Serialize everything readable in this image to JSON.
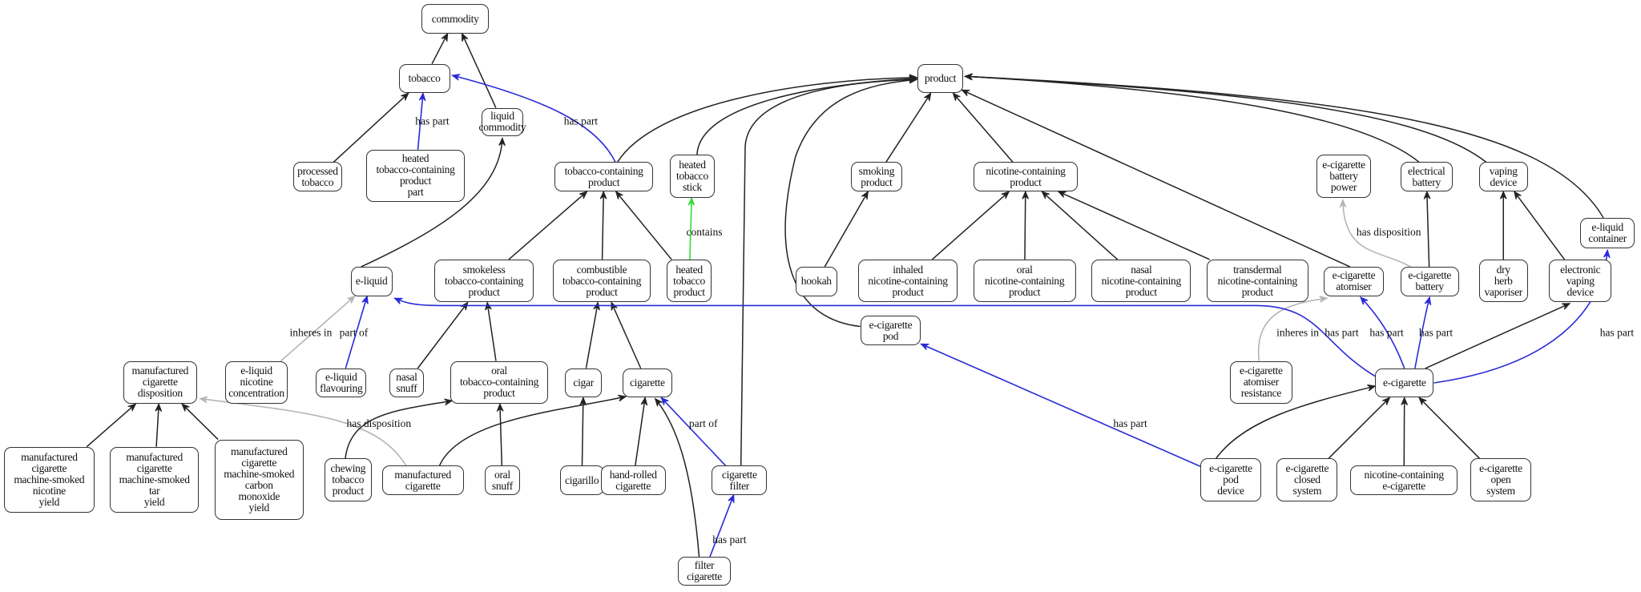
{
  "colors": {
    "is_a": "#222222",
    "has_part": "#2a2ad8",
    "inheres": "#b5b5b5",
    "contains": "#33dd33"
  },
  "nodes": [
    {
      "id": "commodity",
      "label": "commodity"
    },
    {
      "id": "tobacco",
      "label": "tobacco"
    },
    {
      "id": "liquid_commodity",
      "label": "liquid\ncommodity"
    },
    {
      "id": "processed_tobacco",
      "label": "processed\ntobacco"
    },
    {
      "id": "htcp_part",
      "label": "heated\ntobacco-containing\nproduct\npart"
    },
    {
      "id": "tcp",
      "label": "tobacco-containing\nproduct"
    },
    {
      "id": "heated_tobacco_stick",
      "label": "heated\ntobacco\nstick"
    },
    {
      "id": "product",
      "label": "product"
    },
    {
      "id": "smoking_product",
      "label": "smoking\nproduct"
    },
    {
      "id": "ncp",
      "label": "nicotine-containing\nproduct"
    },
    {
      "id": "ecig_battery_power",
      "label": "e-cigarette\nbattery\npower"
    },
    {
      "id": "electrical_battery",
      "label": "electrical\nbattery"
    },
    {
      "id": "vaping_device",
      "label": "vaping\ndevice"
    },
    {
      "id": "eliquid_container",
      "label": "e-liquid\ncontainer"
    },
    {
      "id": "eliquid",
      "label": "e-liquid"
    },
    {
      "id": "smokeless",
      "label": "smokeless\ntobacco-containing\nproduct"
    },
    {
      "id": "combustible",
      "label": "combustible\ntobacco-containing\nproduct"
    },
    {
      "id": "heated_tobacco_product",
      "label": "heated\ntobacco\nproduct"
    },
    {
      "id": "hookah",
      "label": "hookah"
    },
    {
      "id": "inhaled_ncp",
      "label": "inhaled\nnicotine-containing\nproduct"
    },
    {
      "id": "oral_ncp",
      "label": "oral\nnicotine-containing\nproduct"
    },
    {
      "id": "nasal_ncp",
      "label": "nasal\nnicotine-containing\nproduct"
    },
    {
      "id": "transdermal_ncp",
      "label": "transdermal\nnicotine-containing\nproduct"
    },
    {
      "id": "ecig_atomiser",
      "label": "e-cigarette\natomiser"
    },
    {
      "id": "ecig_battery",
      "label": "e-cigarette\nbattery"
    },
    {
      "id": "dry_herb",
      "label": "dry\nherb\nvaporiser"
    },
    {
      "id": "evd",
      "label": "electronic\nvaping\ndevice"
    },
    {
      "id": "ecig_pod",
      "label": "e-cigarette\npod"
    },
    {
      "id": "mcd",
      "label": "manufactured\ncigarette\ndisposition"
    },
    {
      "id": "eliquid_nic_conc",
      "label": "e-liquid\nnicotine\nconcentration"
    },
    {
      "id": "eliquid_flavouring",
      "label": "e-liquid\nflavouring"
    },
    {
      "id": "nasal_snuff",
      "label": "nasal\nsnuff"
    },
    {
      "id": "oral_tcp",
      "label": "oral\ntobacco-containing\nproduct"
    },
    {
      "id": "cigar",
      "label": "cigar"
    },
    {
      "id": "cigarette",
      "label": "cigarette"
    },
    {
      "id": "atomiser_resistance",
      "label": "e-cigarette\natomiser\nresistance"
    },
    {
      "id": "ecig",
      "label": "e-cigarette"
    },
    {
      "id": "mcms_nicotine",
      "label": "manufactured\ncigarette\nmachine-smoked\nnicotine\nyield"
    },
    {
      "id": "mcms_tar",
      "label": "manufactured\ncigarette\nmachine-smoked\ntar\nyield"
    },
    {
      "id": "mcms_co",
      "label": "manufactured\ncigarette\nmachine-smoked\ncarbon\nmonoxide\nyield"
    },
    {
      "id": "chewing",
      "label": "chewing\ntobacco\nproduct"
    },
    {
      "id": "manufactured_cigarette",
      "label": "manufactured\ncigarette"
    },
    {
      "id": "oral_snuff",
      "label": "oral\nsnuff"
    },
    {
      "id": "cigarillo",
      "label": "cigarillo"
    },
    {
      "id": "hand_rolled",
      "label": "hand-rolled\ncigarette"
    },
    {
      "id": "cigarette_filter",
      "label": "cigarette\nfilter"
    },
    {
      "id": "filter_cigarette",
      "label": "filter\ncigarette"
    },
    {
      "id": "pod_device",
      "label": "e-cigarette\npod\ndevice"
    },
    {
      "id": "closed_system",
      "label": "e-cigarette\nclosed\nsystem"
    },
    {
      "id": "nc_ecig",
      "label": "nicotine-containing\ne-cigarette"
    },
    {
      "id": "open_system",
      "label": "e-cigarette\nopen\nsystem"
    }
  ],
  "edges": [
    {
      "from": "tobacco",
      "to": "commodity",
      "type": "is_a",
      "label": ""
    },
    {
      "from": "liquid_commodity",
      "to": "commodity",
      "type": "is_a",
      "label": ""
    },
    {
      "from": "processed_tobacco",
      "to": "tobacco",
      "type": "is_a",
      "label": ""
    },
    {
      "from": "htcp_part",
      "to": "tobacco",
      "type": "has_part",
      "label": "has part"
    },
    {
      "from": "tcp",
      "to": "tobacco",
      "type": "has_part",
      "label": "has part"
    },
    {
      "from": "eliquid",
      "to": "liquid_commodity",
      "type": "is_a",
      "label": ""
    },
    {
      "from": "tcp",
      "to": "product",
      "type": "is_a",
      "label": ""
    },
    {
      "from": "heated_tobacco_stick",
      "to": "product",
      "type": "is_a",
      "label": ""
    },
    {
      "from": "cigarette_filter",
      "to": "product",
      "type": "is_a",
      "label": ""
    },
    {
      "from": "ecig_pod",
      "to": "product",
      "type": "is_a",
      "label": ""
    },
    {
      "from": "smoking_product",
      "to": "product",
      "type": "is_a",
      "label": ""
    },
    {
      "from": "ncp",
      "to": "product",
      "type": "is_a",
      "label": ""
    },
    {
      "from": "ecig_atomiser",
      "to": "product",
      "type": "is_a",
      "label": ""
    },
    {
      "from": "electrical_battery",
      "to": "product",
      "type": "is_a",
      "label": ""
    },
    {
      "from": "vaping_device",
      "to": "product",
      "type": "is_a",
      "label": ""
    },
    {
      "from": "eliquid_container",
      "to": "product",
      "type": "is_a",
      "label": ""
    },
    {
      "from": "smokeless",
      "to": "tcp",
      "type": "is_a",
      "label": ""
    },
    {
      "from": "combustible",
      "to": "tcp",
      "type": "is_a",
      "label": ""
    },
    {
      "from": "heated_tobacco_product",
      "to": "tcp",
      "type": "is_a",
      "label": ""
    },
    {
      "from": "heated_tobacco_product",
      "to": "heated_tobacco_stick",
      "type": "contains",
      "label": "contains"
    },
    {
      "from": "hookah",
      "to": "smoking_product",
      "type": "is_a",
      "label": ""
    },
    {
      "from": "inhaled_ncp",
      "to": "ncp",
      "type": "is_a",
      "label": ""
    },
    {
      "from": "oral_ncp",
      "to": "ncp",
      "type": "is_a",
      "label": ""
    },
    {
      "from": "nasal_ncp",
      "to": "ncp",
      "type": "is_a",
      "label": ""
    },
    {
      "from": "transdermal_ncp",
      "to": "ncp",
      "type": "is_a",
      "label": ""
    },
    {
      "from": "ecig_battery",
      "to": "ecig_battery_power",
      "type": "inheres",
      "label": "has disposition"
    },
    {
      "from": "ecig_battery",
      "to": "electrical_battery",
      "type": "is_a",
      "label": ""
    },
    {
      "from": "dry_herb",
      "to": "vaping_device",
      "type": "is_a",
      "label": ""
    },
    {
      "from": "evd",
      "to": "vaping_device",
      "type": "is_a",
      "label": ""
    },
    {
      "from": "eliquid_nic_conc",
      "to": "eliquid",
      "type": "inheres",
      "label": "inheres in"
    },
    {
      "from": "eliquid_flavouring",
      "to": "eliquid",
      "type": "has_part",
      "label": "part of"
    },
    {
      "from": "nasal_snuff",
      "to": "smokeless",
      "type": "is_a",
      "label": ""
    },
    {
      "from": "oral_tcp",
      "to": "smokeless",
      "type": "is_a",
      "label": ""
    },
    {
      "from": "cigar",
      "to": "combustible",
      "type": "is_a",
      "label": ""
    },
    {
      "from": "cigarette",
      "to": "combustible",
      "type": "is_a",
      "label": ""
    },
    {
      "from": "atomiser_resistance",
      "to": "ecig_atomiser",
      "type": "inheres",
      "label": "inheres in"
    },
    {
      "from": "ecig",
      "to": "eliquid",
      "type": "has_part",
      "label": "has part"
    },
    {
      "from": "ecig",
      "to": "ecig_atomiser",
      "type": "has_part",
      "label": "has part"
    },
    {
      "from": "ecig",
      "to": "ecig_battery",
      "type": "has_part",
      "label": "has part"
    },
    {
      "from": "ecig",
      "to": "eliquid_container",
      "type": "has_part",
      "label": "has part"
    },
    {
      "from": "ecig",
      "to": "evd",
      "type": "is_a",
      "label": ""
    },
    {
      "from": "mcms_nicotine",
      "to": "mcd",
      "type": "is_a",
      "label": ""
    },
    {
      "from": "mcms_tar",
      "to": "mcd",
      "type": "is_a",
      "label": ""
    },
    {
      "from": "mcms_co",
      "to": "mcd",
      "type": "is_a",
      "label": ""
    },
    {
      "from": "manufactured_cigarette",
      "to": "mcd",
      "type": "inheres",
      "label": "has disposition"
    },
    {
      "from": "chewing",
      "to": "oral_tcp",
      "type": "is_a",
      "label": ""
    },
    {
      "from": "manufactured_cigarette",
      "to": "cigarette",
      "type": "is_a",
      "label": ""
    },
    {
      "from": "oral_snuff",
      "to": "oral_tcp",
      "type": "is_a",
      "label": ""
    },
    {
      "from": "cigarillo",
      "to": "cigar",
      "type": "is_a",
      "label": ""
    },
    {
      "from": "hand_rolled",
      "to": "cigarette",
      "type": "is_a",
      "label": ""
    },
    {
      "from": "cigarette_filter",
      "to": "cigarette",
      "type": "has_part",
      "label": "part of"
    },
    {
      "from": "filter_cigarette",
      "to": "cigarette",
      "type": "is_a",
      "label": ""
    },
    {
      "from": "filter_cigarette",
      "to": "cigarette_filter",
      "type": "has_part",
      "label": "has part"
    },
    {
      "from": "pod_device",
      "to": "ecig_pod",
      "type": "has_part",
      "label": "has part"
    },
    {
      "from": "pod_device",
      "to": "ecig",
      "type": "is_a",
      "label": ""
    },
    {
      "from": "closed_system",
      "to": "ecig",
      "type": "is_a",
      "label": ""
    },
    {
      "from": "nc_ecig",
      "to": "ecig",
      "type": "is_a",
      "label": ""
    },
    {
      "from": "open_system",
      "to": "ecig",
      "type": "is_a",
      "label": ""
    }
  ]
}
